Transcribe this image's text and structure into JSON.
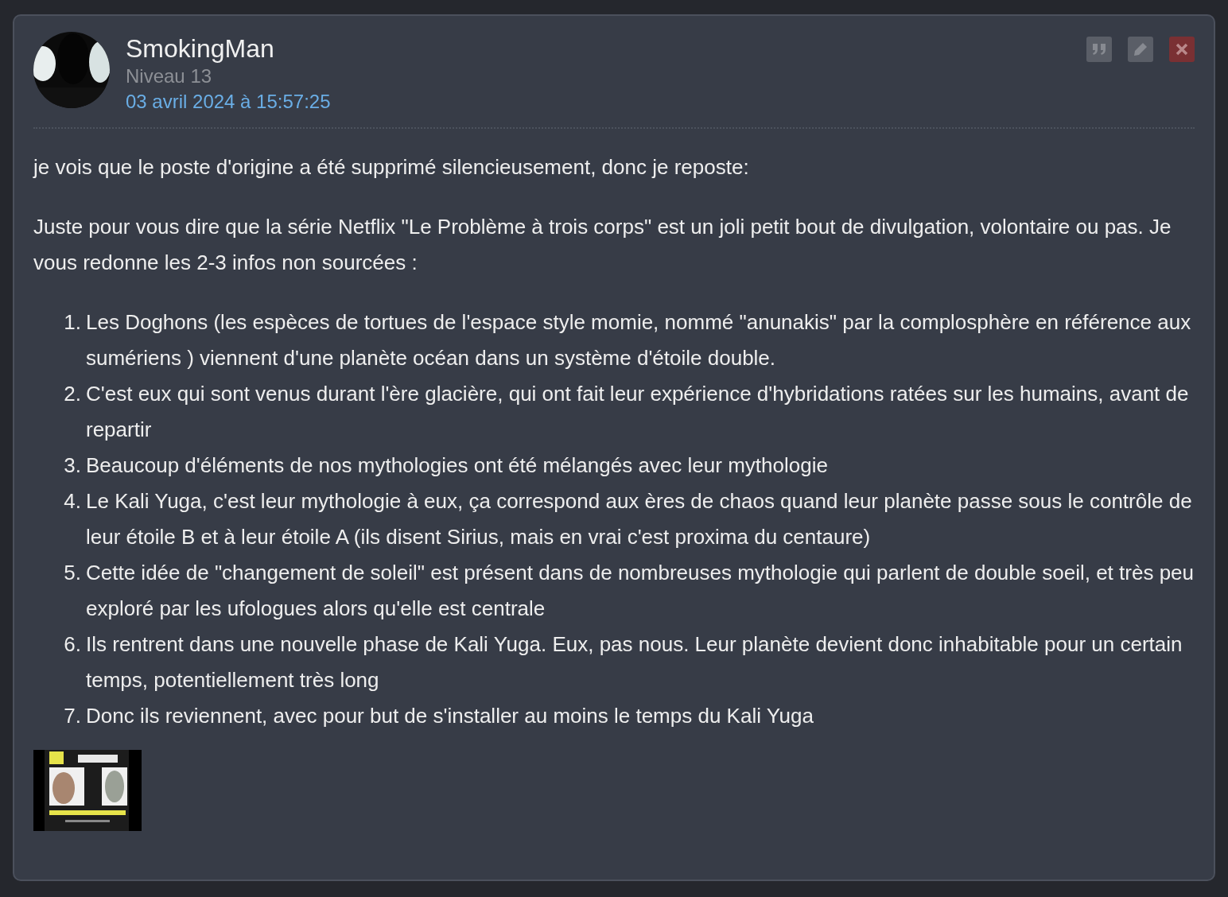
{
  "post": {
    "author": "SmokingMan",
    "level": "Niveau 13",
    "date": "03 avril 2024 à 15:57:25",
    "actions": [
      {
        "kind": "quote"
      },
      {
        "kind": "edit"
      },
      {
        "kind": "delete"
      }
    ],
    "paragraphs": [
      "je vois que le poste d'origine a été supprimé silencieusement, donc je reposte:",
      "Juste pour vous dire que la série Netflix \"Le Problème à trois corps\" est un joli petit bout de divulgation, volontaire ou pas. Je vous redonne les 2-3 infos non sourcées :"
    ],
    "list": [
      {
        "number": "1.",
        "text": "Les Doghons (les espèces de tortues de l'espace style momie, nommé \"anunakis\" par la complosphère en référence aux sumériens ) viennent d'une planète océan dans un système d'étoile double."
      },
      {
        "number": "2.",
        "text": "C'est eux qui sont venus durant l'ère glacière, qui ont fait leur expérience d'hybridations ratées sur les humains, avant de repartir"
      },
      {
        "number": "3.",
        "text": "Beaucoup d'éléments de nos mythologies ont été mélangés avec leur mythologie"
      },
      {
        "number": "4.",
        "text": "Le Kali Yuga, c'est leur mythologie à eux, ça correspond aux ères de chaos quand leur planète passe sous le contrôle de leur étoile B et à leur étoile A (ils disent Sirius, mais en vrai c'est proxima du centaure)"
      },
      {
        "number": "5.",
        "text": "Cette idée de \"changement de soleil\" est présent dans de nombreuses mythologie qui parlent de double soeil, et très peu exploré par les ufologues alors qu'elle est centrale"
      },
      {
        "number": "6.",
        "text": "Ils rentrent dans une nouvelle phase de Kali Yuga. Eux, pas nous. Leur planète devient donc inhabitable pour un certain temps, potentiellement très long"
      },
      {
        "number": "7.",
        "text": "Donc ils reviennent, avec pour but de s'installer au moins le temps du Kali Yuga"
      }
    ],
    "attachment": {
      "kind": "picture"
    }
  }
}
